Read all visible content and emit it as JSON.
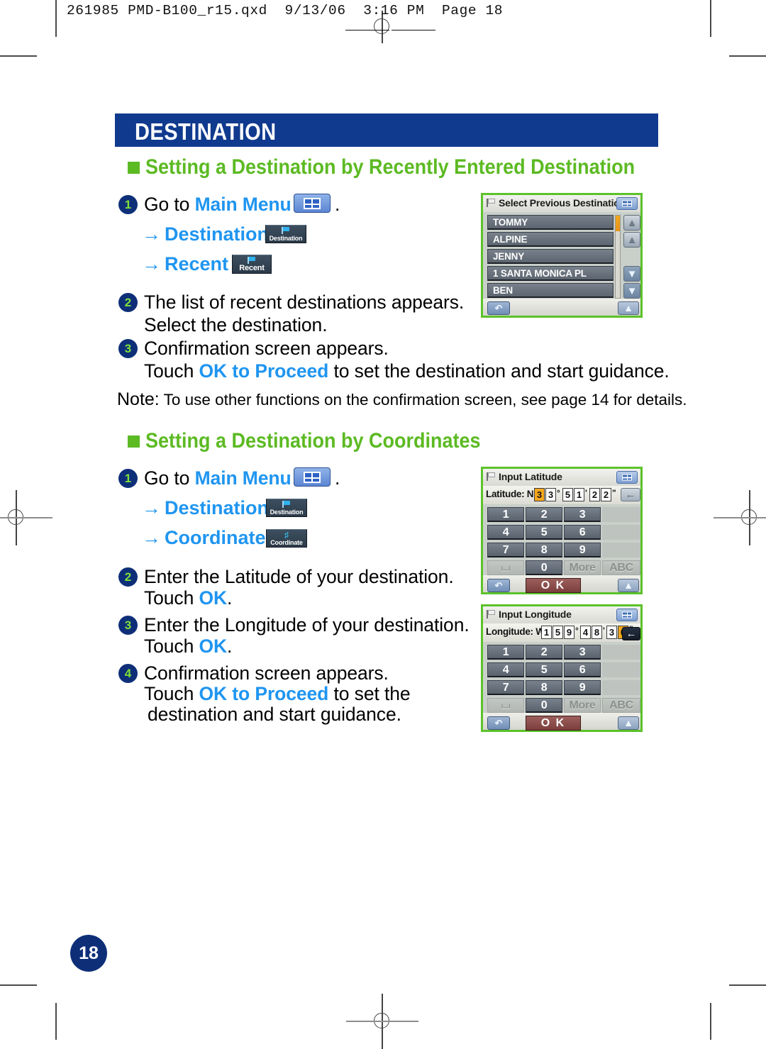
{
  "print": {
    "file_header": "261985 PMD-B100_r15.qxd  9/13/06  3:16 PM  Page 18"
  },
  "page": {
    "title": "DESTINATION",
    "page_number": "18"
  },
  "sections": [
    {
      "heading": "Setting a Destination by Recently Entered Destination",
      "steps": [
        {
          "num": "1",
          "line1_pre": "Go to ",
          "line1_link": "Main Menu",
          "line1_post": ".",
          "paths": [
            {
              "arrow": "→",
              "label": "Destination",
              "chip": {
                "label": "Destination",
                "icon": "flag-icon"
              }
            },
            {
              "arrow": "→",
              "label": "Recent",
              "chip": {
                "label": "Recent",
                "icon": "flag-icon"
              }
            }
          ]
        },
        {
          "num": "2",
          "line1": "The list of recent destinations appears.",
          "line2": "Select the destination."
        },
        {
          "num": "3",
          "line1": "Confirmation screen appears.",
          "line2_pre": "Touch ",
          "line2_link": "OK to Proceed",
          "line2_post": " to set the destination and start guidance."
        }
      ],
      "note_label": "Note:",
      "note_text": " To use other functions on the confirmation screen, see page 14 for details."
    },
    {
      "heading": "Setting a Destination by Coordinates",
      "steps": [
        {
          "num": "1",
          "line1_pre": "Go to ",
          "line1_link": "Main Menu",
          "line1_post": ".",
          "paths": [
            {
              "arrow": "→",
              "label": "Destination",
              "chip": {
                "label": "Destination",
                "icon": "flag-icon"
              }
            },
            {
              "arrow": "→",
              "label": "Coordinate",
              "chip": {
                "label": "Coordinate",
                "icon": "grid-icon"
              }
            }
          ]
        },
        {
          "num": "2",
          "line1": "Enter the Latitude of your destination.",
          "line2_pre": "Touch ",
          "line2_link": "OK",
          "line2_post": "."
        },
        {
          "num": "3",
          "line1": "Enter the Longitude of your destination.",
          "line2_pre": "Touch ",
          "line2_link": "OK",
          "line2_post": "."
        },
        {
          "num": "4",
          "line1": "Confirmation screen appears.",
          "line2_pre": "Touch ",
          "line2_link": "OK to Proceed",
          "line2_post": " to set the",
          "line3": "destination and start guidance."
        }
      ]
    }
  ],
  "devices": {
    "recent_list": {
      "title": "Select Previous Destination",
      "title_icon": "flag-icon",
      "menu_button_icon": "menu-grid-icon",
      "items": [
        "TOMMY",
        "ALPINE",
        "JENNY",
        "1 SANTA MONICA PL",
        "BEN"
      ],
      "scroll_buttons": [
        "page-up-icon",
        "up-icon",
        "down-icon",
        "page-down-icon"
      ],
      "back_button_icon": "back-arrow-icon",
      "north_button_icon": "north-up-icon"
    },
    "latitude": {
      "title": "Input Latitude",
      "title_icon": "flag-icon",
      "menu_button_icon": "menu-grid-icon",
      "field_label": "Latitude:",
      "hemisphere": "N",
      "digits": [
        {
          "v": "3",
          "highlighted": true
        },
        {
          "v": "3",
          "highlighted": false
        },
        {
          "v": "5",
          "highlighted": false
        },
        {
          "v": "1",
          "highlighted": false
        },
        {
          "v": "2",
          "highlighted": false
        },
        {
          "v": "2",
          "highlighted": false
        }
      ],
      "unit_deg": "°",
      "unit_min": "'",
      "unit_sec": "\"",
      "backspace_icon": "left-arrow-icon",
      "backspace_style": "light",
      "keys": [
        "1",
        "2",
        "3",
        "4",
        "5",
        "6",
        "7",
        "8",
        "9"
      ],
      "key_space": "⌴",
      "key_zero": "0",
      "key_more": "More",
      "key_abc": "ABC",
      "ok_label": "O K",
      "back_button_icon": "back-arrow-icon",
      "north_button_icon": "north-up-icon"
    },
    "longitude": {
      "title": "Input Longitude",
      "title_icon": "flag-icon",
      "menu_button_icon": "menu-grid-icon",
      "field_label": "Longitude:",
      "hemisphere": "W",
      "digits": [
        {
          "v": "1",
          "highlighted": false
        },
        {
          "v": "5",
          "highlighted": false
        },
        {
          "v": "9",
          "highlighted": false
        },
        {
          "v": "4",
          "highlighted": false
        },
        {
          "v": "8",
          "highlighted": false
        },
        {
          "v": "3",
          "highlighted": false
        },
        {
          "v": "0",
          "highlighted": true
        }
      ],
      "unit_deg": "°",
      "unit_min": "'",
      "unit_sec": "\"",
      "backspace_icon": "left-arrow-icon",
      "backspace_style": "dark",
      "keys": [
        "1",
        "2",
        "3",
        "4",
        "5",
        "6",
        "7",
        "8",
        "9"
      ],
      "key_space": "⌴",
      "key_zero": "0",
      "key_more": "More",
      "key_abc": "ABC",
      "ok_label": "O K",
      "back_button_icon": "back-arrow-icon",
      "north_button_icon": "north-up-icon"
    }
  },
  "colors": {
    "title_bar": "#103a8e",
    "section_green": "#5cba23",
    "link_blue": "#1f95f0",
    "device_border": "#5cc22a",
    "highlight_orange": "#f7a81c",
    "ok_red": "#7c3f3c"
  }
}
